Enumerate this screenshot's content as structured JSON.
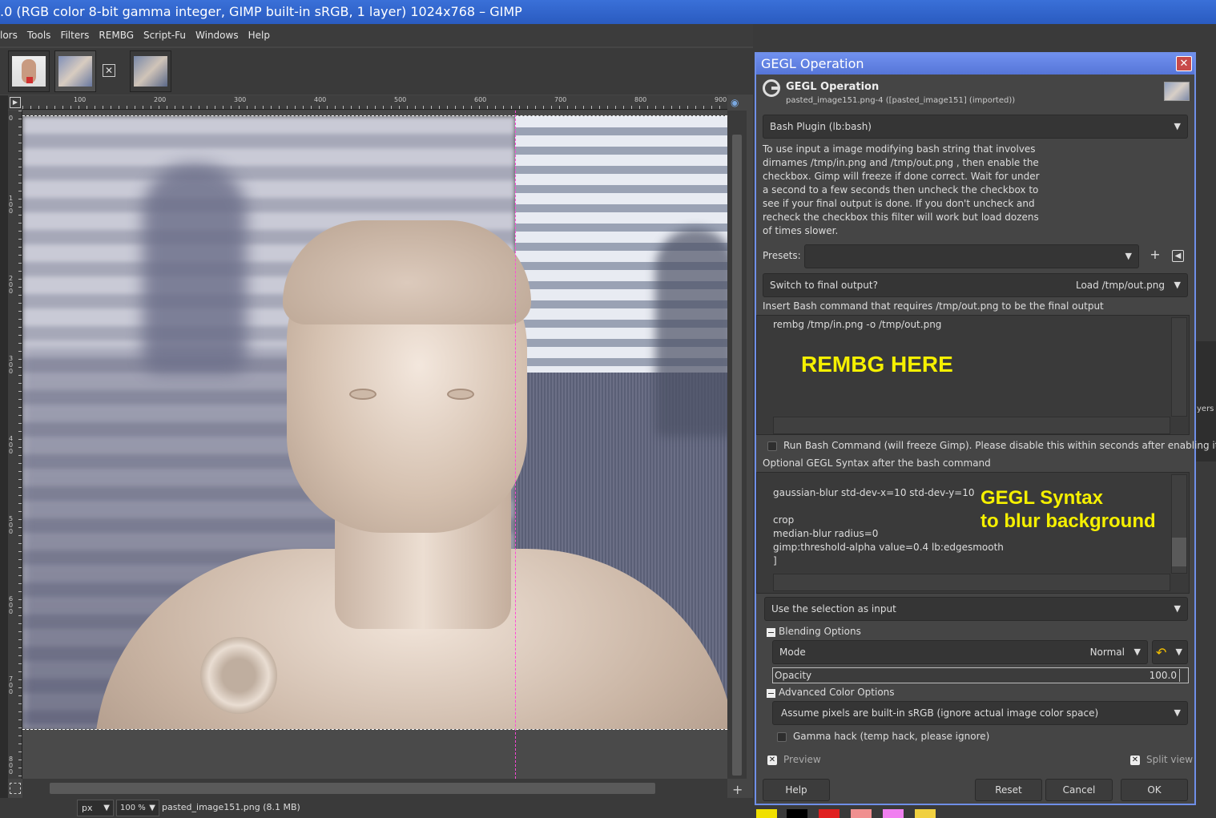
{
  "window": {
    "title": ".0 (RGB color 8-bit gamma integer, GIMP built-in sRGB, 1 layer) 1024x768 – GIMP"
  },
  "menu": {
    "items": [
      "lors",
      "Tools",
      "Filters",
      "REMBG",
      "Script-Fu",
      "Windows",
      "Help"
    ]
  },
  "rulers": {
    "top": [
      "100",
      "200",
      "300",
      "400",
      "500",
      "600",
      "700",
      "800",
      "900"
    ],
    "left": [
      "0",
      "100",
      "200",
      "300",
      "400",
      "500",
      "600",
      "700",
      "800"
    ]
  },
  "status": {
    "unit": "px",
    "zoom": "100 %",
    "file": "pasted_image151.png (8.1 MB)"
  },
  "dock": {
    "layers_fragment": "yers"
  },
  "dialog": {
    "title": "GEGL Operation",
    "close": "✕",
    "heading": "GEGL Operation",
    "subheading": "pasted_image151.png-4 ([pasted_image151] (imported))",
    "operation": "Bash Plugin (lb:bash)",
    "description": "To use input a image modifying bash string that involves dirnames /tmp/in.png and /tmp/out.png , then enable the checkbox. Gimp will freeze if done correct. Wait for under a second to a few seconds  then uncheck the checkbox to see if your final output is done. If you don't uncheck and recheck the checkbox this filter will work but load dozens of times slower.",
    "presets_label": "Presets:",
    "presets_value": "",
    "switch_label": "Switch to final output?",
    "switch_value": "Load /tmp/out.png",
    "bash_label": "Insert Bash command that requires /tmp/out.png to be the final output",
    "bash_text": "rembg /tmp/in.png -o /tmp/out.png",
    "bash_annotation": "REMBG HERE",
    "run_label": "Run Bash Command (will freeze Gimp). Please disable this within seconds after enabling it.",
    "gegl_label": "Optional GEGL Syntax after the bash command",
    "gegl_text": "\ngaussian-blur std-dev-x=10 std-dev-y=10\n\ncrop\nmedian-blur radius=0\ngimp:threshold-alpha value=0.4 lb:edgesmooth\n]",
    "gegl_annotation_1": "GEGL Syntax",
    "gegl_annotation_2": "to blur background",
    "input_mode": "Use the selection as input",
    "blending_label": "Blending Options",
    "mode_label": "Mode",
    "mode_value": "Normal",
    "opacity_label": "Opacity",
    "opacity_value": "100.0",
    "opacity_fraction": 1.0,
    "advanced_label": "Advanced Color Options",
    "color_space": "Assume pixels are built-in sRGB (ignore actual image color space)",
    "gamma_label": "Gamma hack (temp hack, please ignore)",
    "preview_label": "Preview",
    "split_label": "Split view",
    "help": "Help",
    "reset": "Reset",
    "cancel": "Cancel",
    "ok": "OK"
  },
  "colors": {
    "accent": "#6f8fe8",
    "annotation": "#f5f000",
    "guide": "#ff4ad8",
    "swatches": [
      "#f0e000",
      "#000000",
      "#e02020",
      "#f09090",
      "#f080f0",
      "#f0d040"
    ]
  }
}
